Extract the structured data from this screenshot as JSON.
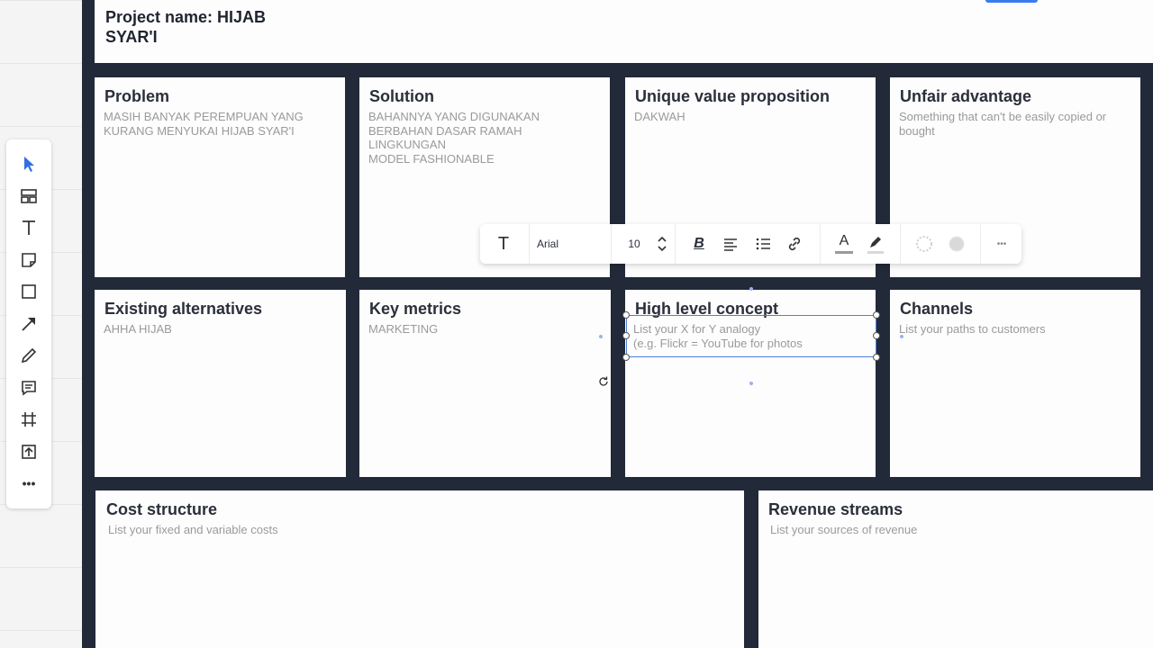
{
  "project": {
    "title_line1": "Project name: HIJAB",
    "title_line2": "SYAR'I"
  },
  "cards": {
    "problem": {
      "title": "Problem",
      "body": "MASIH BANYAK PEREMPUAN YANG\nKURANG MENYUKAI HIJAB SYAR'I"
    },
    "solution": {
      "title": "Solution",
      "body": "BAHANNYA YANG DIGUNAKAN\nBERBAHAN DASAR RAMAH\nLINGKUNGAN\nMODEL FASHIONABLE"
    },
    "uvp": {
      "title": "Unique value proposition",
      "body": "DAKWAH"
    },
    "unfair": {
      "title": "Unfair advantage",
      "body": "Something that can't be easily copied or\nbought"
    },
    "existing": {
      "title": "Existing alternatives",
      "body": "AHHA HIJAB"
    },
    "metrics": {
      "title": "Key metrics",
      "body": "MARKETING"
    },
    "concept": {
      "title": "High level concept",
      "body": "List your X for Y analogy\n(e.g. Flickr = YouTube for photos"
    },
    "channels": {
      "title": "Channels",
      "body": "List your paths to customers"
    },
    "cost": {
      "title": "Cost structure",
      "body": "List your fixed and variable costs"
    },
    "revenue": {
      "title": "Revenue streams",
      "body": "List your sources of revenue"
    }
  },
  "format_toolbar": {
    "text_icon": "T",
    "font_name": "Arial",
    "font_size": "10",
    "bold_label": "B",
    "text_color_label": "A",
    "more_label": "•••"
  },
  "left_toolbar": {
    "tools": [
      "select-icon",
      "templates-icon",
      "text-icon",
      "sticky-note-icon",
      "shape-icon",
      "arrow-icon",
      "pen-icon",
      "comment-icon",
      "frame-icon",
      "upload-icon",
      "more-icon"
    ],
    "more_label": "•••"
  },
  "colors": {
    "frame": "#222938",
    "accent": "#3a7bf0",
    "select_blue": "#2f6fe4"
  }
}
